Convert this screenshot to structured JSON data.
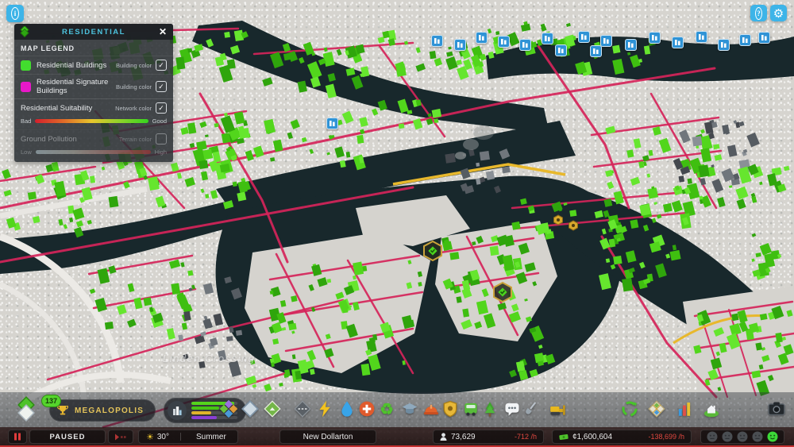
{
  "top_buttons": {
    "info_glyph": "i",
    "help_glyph": "?",
    "settings_icon": "gear"
  },
  "legend_panel": {
    "title": "RESIDENTIAL",
    "section_title": "MAP LEGEND",
    "rows": [
      {
        "label": "Residential Buildings",
        "type_label": "Building color",
        "checked": true,
        "swatch": "#42dd2e"
      },
      {
        "label": "Residential Signature Buildings",
        "type_label": "Building color",
        "checked": true,
        "swatch": "#e818c8"
      },
      {
        "label": "Residential Suitability",
        "type_label": "Network color",
        "checked": true,
        "scale_min": "Bad",
        "scale_max": "Good",
        "gradient": [
          "#d41f2c",
          "#e06a28",
          "#e8c62c",
          "#8ed32a",
          "#35d41e"
        ]
      },
      {
        "label": "Ground Pollution",
        "type_label": "Terrain color",
        "checked": false,
        "disabled": true,
        "scale_min": "Low",
        "scale_max": "High",
        "gradient": [
          "#cfe8f0",
          "#d8d2c2",
          "#d8847a",
          "#d42828"
        ]
      }
    ]
  },
  "milestone": {
    "count_badge": "137",
    "name": "MEGALOPOLIS",
    "progress_bars": [
      {
        "color": "#55d41c",
        "pct": 93
      },
      {
        "color": "#46c414",
        "pct": 60
      },
      {
        "color": "#e0b42c",
        "pct": 43
      },
      {
        "color": "#8a3fd4",
        "pct": 55
      }
    ]
  },
  "toolbar": {
    "items": [
      "zoning",
      "districts",
      "map-tiles",
      "roads",
      "electricity",
      "water",
      "health",
      "garbage",
      "education",
      "fire",
      "police",
      "transport",
      "parks",
      "info-chat",
      "landscaping",
      "bulldozer",
      "environment",
      "map-overview",
      "statistics",
      "nature",
      "photo-mode"
    ]
  },
  "status_bar": {
    "sim_state": "PAUSED",
    "temperature": "30°",
    "season": "Summer",
    "city_name": "New Dollarton",
    "population": "73,629",
    "population_rate": "-712 /h",
    "money": "¢1,600,604",
    "money_rate": "-138,699 /h",
    "happiness": {
      "levels": 5,
      "active_index": 4,
      "active_color": "#3cd838"
    }
  },
  "map": {
    "district_label": "Linden Crossing"
  },
  "colors": {
    "accent_cyan": "#3db4e8",
    "residential_green": "#42dd2e",
    "road_overlay_red": "#d5245a",
    "water": "#18282c",
    "frame_red": "#c42f2f"
  }
}
